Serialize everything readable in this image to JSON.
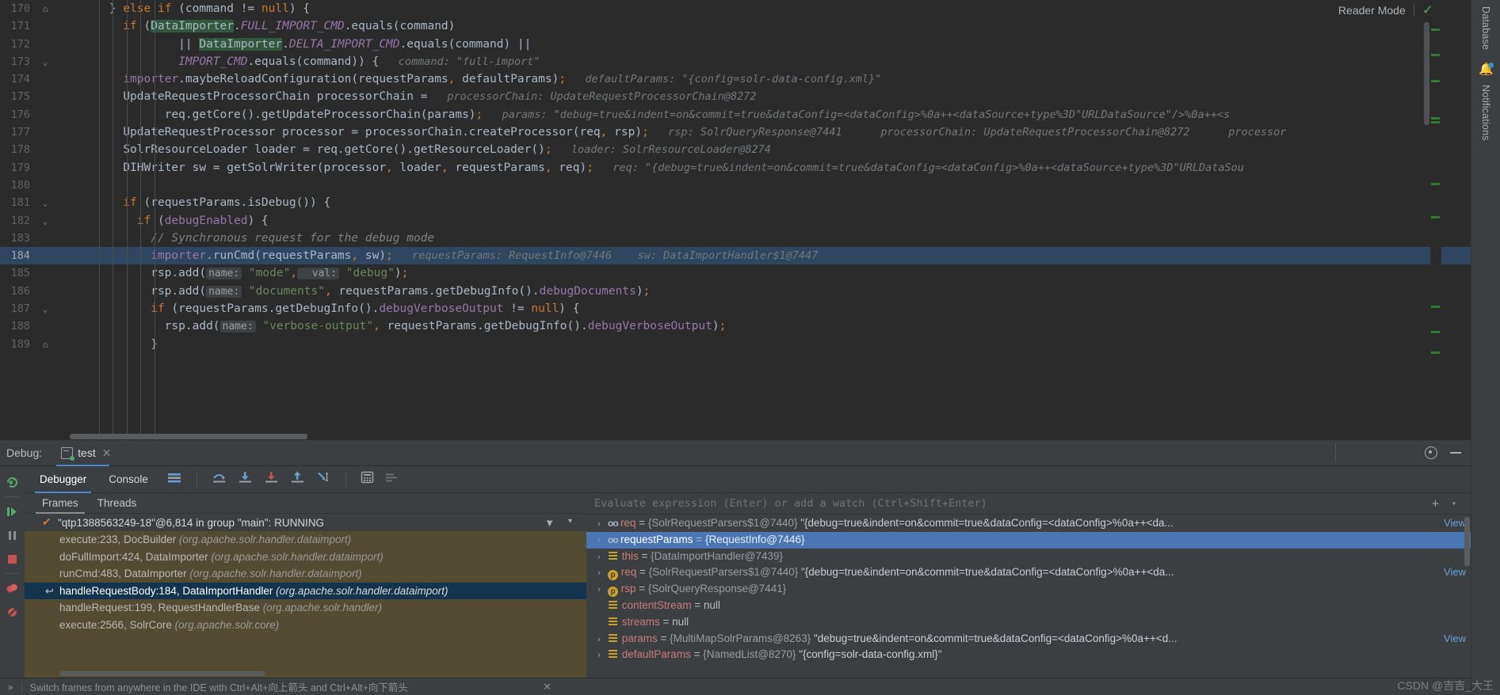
{
  "editor": {
    "reader_mode_label": "Reader Mode",
    "reader_check_icon": "check-icon",
    "lines": [
      {
        "num": "170",
        "fold": "⌂",
        "indent": 4,
        "tokens": [
          [
            "plain",
            "} "
          ],
          [
            "kw",
            "else if"
          ],
          [
            "plain",
            " (command != "
          ],
          [
            "kw",
            "null"
          ],
          [
            "plain",
            ") {"
          ]
        ]
      },
      {
        "num": "171",
        "fold": "",
        "indent": 5,
        "tokens": [
          [
            "kw",
            "if"
          ],
          [
            "plain",
            " ("
          ],
          [
            "searchhl",
            "DataImporter"
          ],
          [
            "plain",
            "."
          ],
          [
            "sfld",
            "FULL_IMPORT_CMD"
          ],
          [
            "plain",
            ".equals(command)"
          ]
        ]
      },
      {
        "num": "172",
        "fold": "",
        "indent": 9,
        "tokens": [
          [
            "plain",
            "|| "
          ],
          [
            "searchhl",
            "DataImporter"
          ],
          [
            "plain",
            "."
          ],
          [
            "sfld",
            "DELTA_IMPORT_CMD"
          ],
          [
            "plain",
            ".equals(command) ||"
          ]
        ]
      },
      {
        "num": "173",
        "fold": "⌄",
        "indent": 9,
        "tokens": [
          [
            "sfld",
            "IMPORT_CMD"
          ],
          [
            "plain",
            ".equals(command)) {"
          ],
          [
            "hint",
            "   command: \"full-import\""
          ]
        ]
      },
      {
        "num": "174",
        "fold": "",
        "indent": 5,
        "tokens": [
          [
            "fld",
            "importer"
          ],
          [
            "plain",
            ".maybeReloadConfiguration(requestParams"
          ],
          [
            "kw",
            ","
          ],
          [
            "plain",
            " defaultParams)"
          ],
          [
            "kw",
            ";"
          ],
          [
            "hint",
            "   defaultParams: \"{config=solr-data-config.xml}\""
          ]
        ]
      },
      {
        "num": "175",
        "fold": "",
        "indent": 5,
        "tokens": [
          [
            "plain",
            "UpdateRequestProcessorChain processorChain = "
          ],
          [
            "hint",
            "  processorChain: UpdateRequestProcessorChain@8272"
          ]
        ]
      },
      {
        "num": "176",
        "fold": "",
        "indent": 8,
        "tokens": [
          [
            "plain",
            "req.getCore().getUpdateProcessorChain(params)"
          ],
          [
            "kw",
            ";"
          ],
          [
            "hint",
            "   params: \"debug=true&indent=on&commit=true&dataConfig=<dataConfig>%0a++<dataSource+type%3D\"URLDataSource\"/>%0a++<s"
          ]
        ]
      },
      {
        "num": "177",
        "fold": "",
        "indent": 5,
        "tokens": [
          [
            "plain",
            "UpdateRequestProcessor processor = processorChain.createProcessor(req"
          ],
          [
            "kw",
            ","
          ],
          [
            "plain",
            " rsp)"
          ],
          [
            "kw",
            ";"
          ],
          [
            "hint",
            "   rsp: SolrQueryResponse@7441      processorChain: UpdateRequestProcessorChain@8272      processor"
          ]
        ]
      },
      {
        "num": "178",
        "fold": "",
        "indent": 5,
        "tokens": [
          [
            "plain",
            "SolrResourceLoader loader = req.getCore().getResourceLoader()"
          ],
          [
            "kw",
            ";"
          ],
          [
            "hint",
            "   loader: SolrResourceLoader@8274"
          ]
        ]
      },
      {
        "num": "179",
        "fold": "",
        "indent": 5,
        "tokens": [
          [
            "plain",
            "DIHWriter sw = getSolrWriter(processor"
          ],
          [
            "kw",
            ","
          ],
          [
            "plain",
            " loader"
          ],
          [
            "kw",
            ","
          ],
          [
            "plain",
            " requestParams"
          ],
          [
            "kw",
            ","
          ],
          [
            "plain",
            " req)"
          ],
          [
            "kw",
            ";"
          ],
          [
            "hint",
            "   req: \"{debug=true&indent=on&commit=true&dataConfig=<dataConfig>%0a++<dataSource+type%3D\"URLDataSou"
          ]
        ]
      },
      {
        "num": "180",
        "fold": "",
        "indent": 0,
        "tokens": [
          [
            "plain",
            ""
          ]
        ]
      },
      {
        "num": "181",
        "fold": "⌄",
        "indent": 5,
        "tokens": [
          [
            "kw",
            "if"
          ],
          [
            "plain",
            " (requestParams.isDebug()) {"
          ]
        ]
      },
      {
        "num": "182",
        "fold": "⌄",
        "indent": 6,
        "tokens": [
          [
            "kw",
            "if"
          ],
          [
            "plain",
            " ("
          ],
          [
            "fld",
            "debugEnabled"
          ],
          [
            "plain",
            ") {"
          ]
        ]
      },
      {
        "num": "183",
        "fold": "",
        "indent": 7,
        "tokens": [
          [
            "cmt",
            "// Synchronous request for the debug mode"
          ]
        ]
      },
      {
        "num": "184",
        "fold": "",
        "indent": 7,
        "highlight": true,
        "tokens": [
          [
            "fld",
            "importer"
          ],
          [
            "plain",
            ".runCmd(requestParams"
          ],
          [
            "kw",
            ","
          ],
          [
            "plain",
            " sw)"
          ],
          [
            "kw",
            ";"
          ],
          [
            "hint",
            "   requestParams: RequestInfo@7446    sw: DataImportHandler$1@7447"
          ]
        ]
      },
      {
        "num": "185",
        "fold": "",
        "indent": 7,
        "tokens": [
          [
            "plain",
            "rsp.add("
          ],
          [
            "pbadge",
            "name:"
          ],
          [
            "str",
            " \"mode\""
          ],
          [
            "kw",
            ","
          ],
          [
            "pbadge",
            "  val:"
          ],
          [
            "str",
            " \"debug\""
          ],
          [
            "plain",
            ")"
          ],
          [
            "kw",
            ";"
          ]
        ]
      },
      {
        "num": "186",
        "fold": "",
        "indent": 7,
        "tokens": [
          [
            "plain",
            "rsp.add("
          ],
          [
            "pbadge",
            "name:"
          ],
          [
            "str",
            " \"documents\""
          ],
          [
            "kw",
            ","
          ],
          [
            "plain",
            " requestParams.getDebugInfo()."
          ],
          [
            "fld",
            "debugDocuments"
          ],
          [
            "plain",
            ")"
          ],
          [
            "kw",
            ";"
          ]
        ]
      },
      {
        "num": "187",
        "fold": "⌄",
        "indent": 7,
        "tokens": [
          [
            "kw",
            "if"
          ],
          [
            "plain",
            " (requestParams.getDebugInfo()."
          ],
          [
            "fld",
            "debugVerboseOutput"
          ],
          [
            "plain",
            " != "
          ],
          [
            "kw",
            "null"
          ],
          [
            "plain",
            ") {"
          ]
        ]
      },
      {
        "num": "188",
        "fold": "",
        "indent": 8,
        "tokens": [
          [
            "plain",
            "rsp.add("
          ],
          [
            "pbadge",
            "name:"
          ],
          [
            "str",
            " \"verbose-output\""
          ],
          [
            "kw",
            ","
          ],
          [
            "plain",
            " requestParams.getDebugInfo()."
          ],
          [
            "fld",
            "debugVerboseOutput"
          ],
          [
            "plain",
            ")"
          ],
          [
            "kw",
            ";"
          ]
        ]
      },
      {
        "num": "189",
        "fold": "⌂",
        "indent": 7,
        "tokens": [
          [
            "plain",
            "}"
          ]
        ]
      }
    ]
  },
  "right_strip": {
    "database_label": "Database",
    "notifications_label": "Notifications",
    "bell_icon": "bell-icon"
  },
  "debug": {
    "panel_label": "Debug:",
    "session_tab": "test",
    "session_icon": "rerun-icon",
    "close_icon": "close-icon",
    "settings_icon": "gear-icon",
    "minimize_icon": "minimize-icon",
    "tabs": [
      {
        "label": "Debugger",
        "active": true
      },
      {
        "label": "Console",
        "active": false
      }
    ],
    "toolbar_icons": [
      "layout-icon",
      "step-over-icon",
      "step-into-icon",
      "force-step-into-icon",
      "step-out-icon",
      "run-to-cursor-icon",
      "evaluate-icon",
      "mute-breakpoints-icon"
    ],
    "rail_icons": [
      "rerun-icon",
      "resume-icon",
      "pause-icon",
      "stop-icon",
      "view-breakpoints-icon",
      "mute-breakpoints-icon"
    ],
    "frames": {
      "tabs": [
        {
          "label": "Frames",
          "active": true
        },
        {
          "label": "Threads",
          "active": false
        }
      ],
      "thread": "\"qtp1388563249-18\"@6,814 in group \"main\": RUNNING",
      "thread_state_icon": "check-icon",
      "filter_icon": "filter-icon",
      "dropdown_icon": "chevron-down-icon",
      "items": [
        {
          "method": "execute:233, DocBuilder",
          "pkg": "(org.apache.solr.handler.dataimport)",
          "selected": false
        },
        {
          "method": "doFullImport:424, DataImporter",
          "pkg": "(org.apache.solr.handler.dataimport)",
          "selected": false
        },
        {
          "method": "runCmd:483, DataImporter",
          "pkg": "(org.apache.solr.handler.dataimport)",
          "selected": false
        },
        {
          "method": "handleRequestBody:184, DataImportHandler",
          "pkg": "(org.apache.solr.handler.dataimport)",
          "selected": true,
          "marker": "↩"
        },
        {
          "method": "handleRequest:199, RequestHandlerBase",
          "pkg": "(org.apache.solr.handler)",
          "selected": false
        },
        {
          "method": "execute:2566, SolrCore",
          "pkg": "(org.apache.solr.core)",
          "selected": false
        }
      ]
    },
    "variables": {
      "evaluate_placeholder": "Evaluate expression (Enter) or add a watch (Ctrl+Shift+Enter)",
      "add_watch_icon": "plus-icon",
      "history_icon": "chevron-down-icon",
      "view_label": "View",
      "rows": [
        {
          "chev": "›",
          "icon": "oo",
          "name": "req",
          "eq": " = ",
          "ref": "{SolrRequestParsers$1@7440}",
          "value": "\"{debug=true&indent=on&commit=true&dataConfig=<dataConfig>%0a++<da...",
          "view": "View",
          "selected": false
        },
        {
          "chev": "›",
          "icon": "oo",
          "name": "requestParams",
          "eq": " = ",
          "ref": "{RequestInfo@7446}",
          "value": "",
          "view": "",
          "selected": true
        },
        {
          "chev": "›",
          "icon": "list",
          "name": "this",
          "eq": " = ",
          "ref": "{DataImportHandler@7439}",
          "value": "",
          "view": "",
          "selected": false
        },
        {
          "chev": "›",
          "icon": "p",
          "name": "req",
          "eq": " = ",
          "ref": "{SolrRequestParsers$1@7440}",
          "value": "\"{debug=true&indent=on&commit=true&dataConfig=<dataConfig>%0a++<da...",
          "view": "View",
          "selected": false
        },
        {
          "chev": "›",
          "icon": "p",
          "name": "rsp",
          "eq": " = ",
          "ref": "{SolrQueryResponse@7441}",
          "value": "",
          "view": "",
          "selected": false
        },
        {
          "chev": "",
          "icon": "list",
          "name": "contentStream",
          "eq": " = ",
          "ref": "",
          "value": "null",
          "view": "",
          "selected": false
        },
        {
          "chev": "",
          "icon": "list",
          "name": "streams",
          "eq": " = ",
          "ref": "",
          "value": "null",
          "view": "",
          "selected": false
        },
        {
          "chev": "›",
          "icon": "list",
          "name": "params",
          "eq": " = ",
          "ref": "{MultiMapSolrParams@8263}",
          "value": "\"debug=true&indent=on&commit=true&dataConfig=<dataConfig>%0a++<d...",
          "view": "View",
          "selected": false
        },
        {
          "chev": "›",
          "icon": "list",
          "name": "defaultParams",
          "eq": " = ",
          "ref": "{NamedList@8270}",
          "value": "\"{config=solr-data-config.xml}\"",
          "view": "",
          "selected": false
        }
      ]
    },
    "status_tip": "Switch frames from anywhere in the IDE with Ctrl+Alt+向上箭头 and Ctrl+Alt+向下箭头",
    "status_expand_icon": "chevrons-right-icon",
    "status_close_icon": "close-icon"
  },
  "watermark": "CSDN @吉吉_大王",
  "colors": {
    "editor_bg": "#2b2b2b",
    "panel_bg": "#3c3f41",
    "selection_blue": "#4a77b4",
    "frame_selected": "#13344e",
    "frames_bg": "#544b33",
    "accent": "#4a88c7",
    "current_line": "#323a42",
    "exec_line": "#2f4661"
  }
}
